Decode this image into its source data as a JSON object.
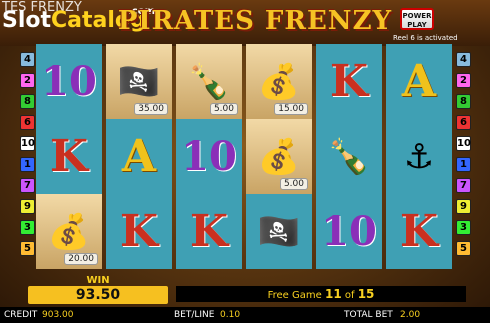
{
  "header": {
    "tab_title": "TES FRENZY",
    "logo_part1": "Slot",
    "logo_part2": "Catalog",
    "logo_com": ".com",
    "game_title": "PIRATES FRENZY",
    "power_play": "POWER PLAY",
    "reel_status": "Reel 6 is activated"
  },
  "reels": [
    [
      {
        "kind": "t",
        "text": "10"
      },
      {
        "kind": "k",
        "text": "K"
      },
      {
        "kind": "bag",
        "badge": "20.00"
      }
    ],
    [
      {
        "kind": "pirate",
        "badge": "35.00"
      },
      {
        "kind": "a",
        "text": "A"
      },
      {
        "kind": "k",
        "text": "K"
      }
    ],
    [
      {
        "kind": "bottle",
        "badge": "5.00"
      },
      {
        "kind": "t",
        "text": "10"
      },
      {
        "kind": "k",
        "text": "K"
      }
    ],
    [
      {
        "kind": "bag",
        "badge": "15.00"
      },
      {
        "kind": "bag",
        "badge": "5.00"
      },
      {
        "kind": "pirate"
      }
    ],
    [
      {
        "kind": "k",
        "text": "K"
      },
      {
        "kind": "bottle"
      },
      {
        "kind": "t",
        "text": "10"
      }
    ],
    [
      {
        "kind": "a",
        "text": "A"
      },
      {
        "kind": "anchor"
      },
      {
        "kind": "k",
        "text": "K"
      }
    ]
  ],
  "left_numbers": [
    "4",
    "2",
    "8",
    "6",
    "10",
    "1",
    "7",
    "9",
    "3",
    "5"
  ],
  "right_numbers": [
    "4",
    "2",
    "8",
    "6",
    "10",
    "1",
    "7",
    "9",
    "3",
    "5"
  ],
  "win": {
    "label": "WIN",
    "value": "93.50"
  },
  "free_game": {
    "prefix": "Free Game",
    "current": "11",
    "of": "of",
    "total": "15"
  },
  "footer": {
    "credit_label": "CREDIT",
    "credit_value": "903.00",
    "betline_label": "BET/LINE",
    "betline_value": "0.10",
    "totalbet_label": "TOTAL BET",
    "totalbet_value": "2.00"
  },
  "colors": {
    "accent": "#f8d020",
    "reel_bg": "#3fa0b4",
    "card_k": "#c93020",
    "card_a": "#f0c21c",
    "card_10": "#8a2fb8"
  }
}
